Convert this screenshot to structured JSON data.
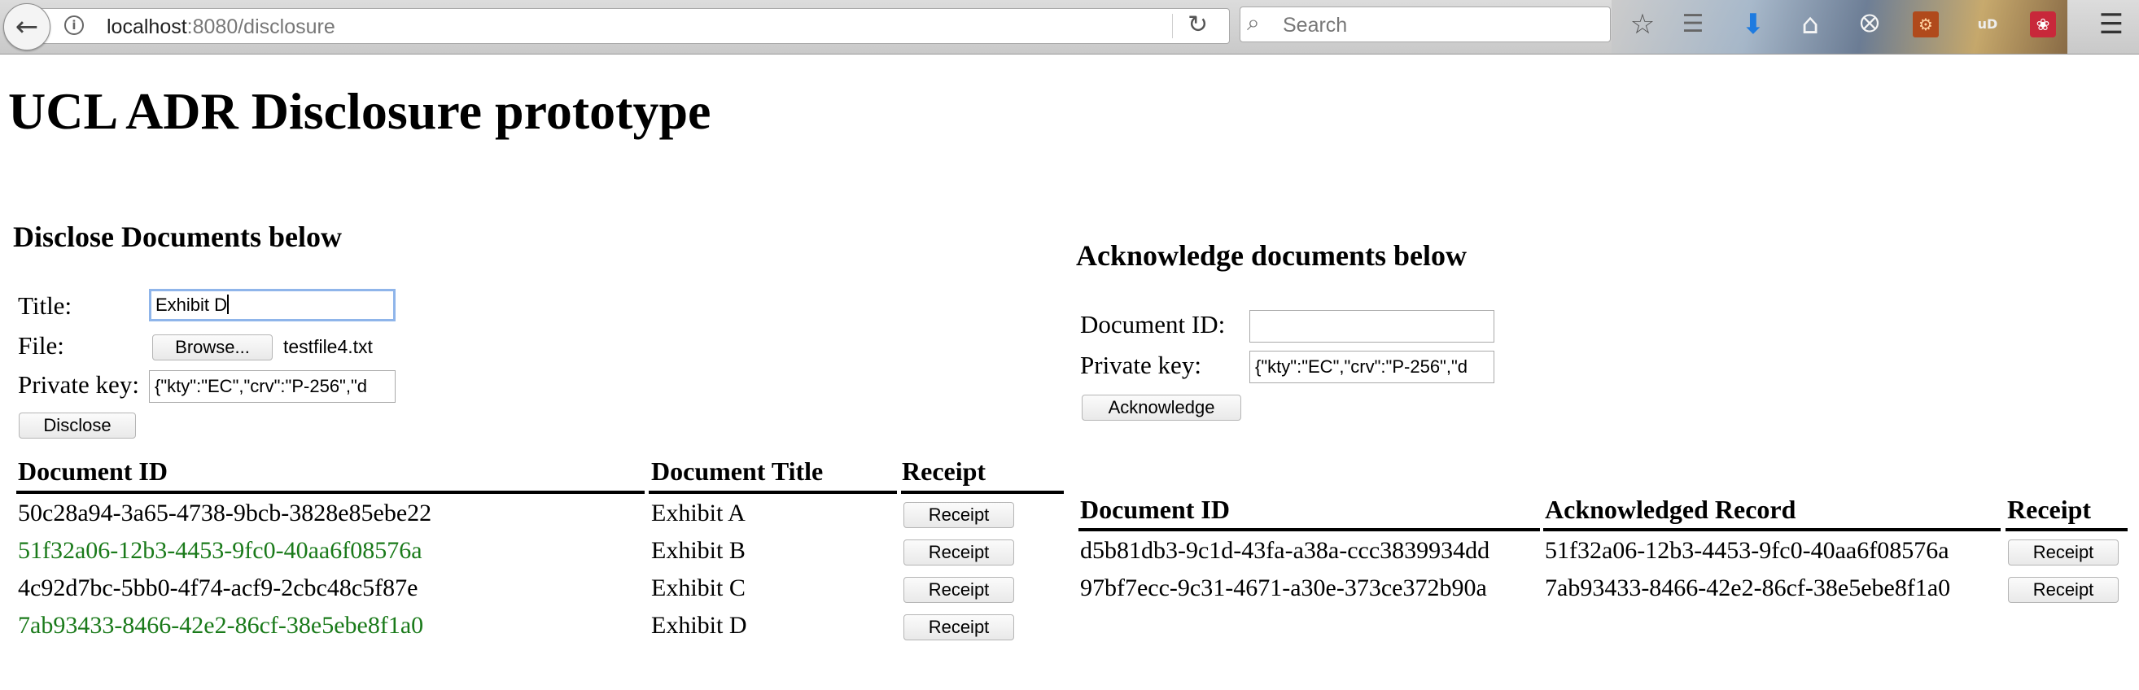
{
  "browser": {
    "url_host": "localhost",
    "url_rest": ":8080/disclosure",
    "search_placeholder": "Search",
    "icons": [
      "back-icon",
      "info-icon",
      "reload-icon",
      "search-icon",
      "bookmark-star-icon",
      "reading-list-icon",
      "download-icon",
      "home-icon",
      "pocket-icon",
      "extension-icon",
      "ublock-icon",
      "extension-paw-icon",
      "menu-icon"
    ]
  },
  "page": {
    "title": "UCL ADR Disclosure prototype"
  },
  "disclose": {
    "heading": "Disclose Documents below",
    "title_label": "Title:",
    "title_value": "Exhibit D",
    "file_label": "File:",
    "browse_label": "Browse...",
    "file_name": "testfile4.txt",
    "key_label": "Private key:",
    "key_value": "{\"kty\":\"EC\",\"crv\":\"P-256\",\"d",
    "submit_label": "Disclose",
    "table": {
      "headers": [
        "Document ID",
        "Document Title",
        "Receipt"
      ],
      "receipt_label": "Receipt",
      "rows": [
        {
          "id": "50c28a94-3a65-4738-9bcb-3828e85ebe22",
          "title": "Exhibit A",
          "acknowledged": false
        },
        {
          "id": "51f32a06-12b3-4453-9fc0-40aa6f08576a",
          "title": "Exhibit B",
          "acknowledged": true
        },
        {
          "id": "4c92d7bc-5bb0-4f74-acf9-2cbc48c5f87e",
          "title": "Exhibit C",
          "acknowledged": false
        },
        {
          "id": "7ab93433-8466-42e2-86cf-38e5ebe8f1a0",
          "title": "Exhibit D",
          "acknowledged": true
        }
      ]
    }
  },
  "acknowledge": {
    "heading": "Acknowledge documents below",
    "doc_label": "Document ID:",
    "doc_value": "",
    "key_label": "Private key:",
    "key_value": "{\"kty\":\"EC\",\"crv\":\"P-256\",\"d",
    "submit_label": "Acknowledge",
    "table": {
      "headers": [
        "Document ID",
        "Acknowledged Record",
        "Receipt"
      ],
      "receipt_label": "Receipt",
      "rows": [
        {
          "id": "d5b81db3-9c1d-43fa-a38a-ccc3839934dd",
          "record": "51f32a06-12b3-4453-9fc0-40aa6f08576a"
        },
        {
          "id": "97bf7ecc-9c31-4671-a30e-373ce372b90a",
          "record": "7ab93433-8466-42e2-86cf-38e5ebe8f1a0"
        }
      ]
    }
  },
  "colors": {
    "acknowledged_text": "#1a7a1a",
    "focus_ring": "#8fb5ea"
  }
}
